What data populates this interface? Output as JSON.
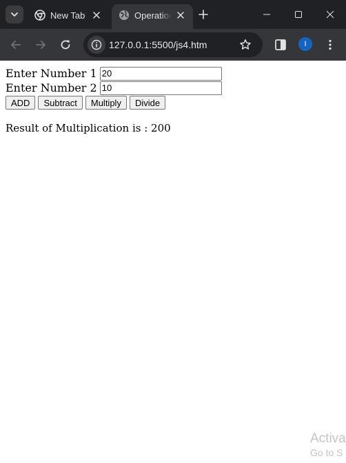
{
  "browser": {
    "tabs": [
      {
        "title": "New Tab",
        "favicon": "chrome-icon",
        "active": false
      },
      {
        "title": "Operation",
        "favicon": "globe-icon",
        "active": true
      }
    ],
    "new_tab_icon": "plus-icon",
    "window_controls": [
      "minimize-icon",
      "maximize-icon",
      "close-icon"
    ],
    "address_bar": {
      "url": "127.0.0.1:5500/js4.htm"
    },
    "profile_initial": "I",
    "colors": {
      "tabstrip": "#202124",
      "toolbar": "#35363a",
      "profile": "#1565c0"
    }
  },
  "page": {
    "number1": {
      "label": "Enter Number 1",
      "value": "20"
    },
    "number2": {
      "label": "Enter Number 2",
      "value": "10"
    },
    "buttons": {
      "add": "ADD",
      "subtract": "Subtract",
      "multiply": "Multiply",
      "divide": "Divide"
    },
    "result": "Result of Multiplication is : 200"
  },
  "watermark": {
    "line1": "Activa",
    "line2": "Go to S"
  }
}
